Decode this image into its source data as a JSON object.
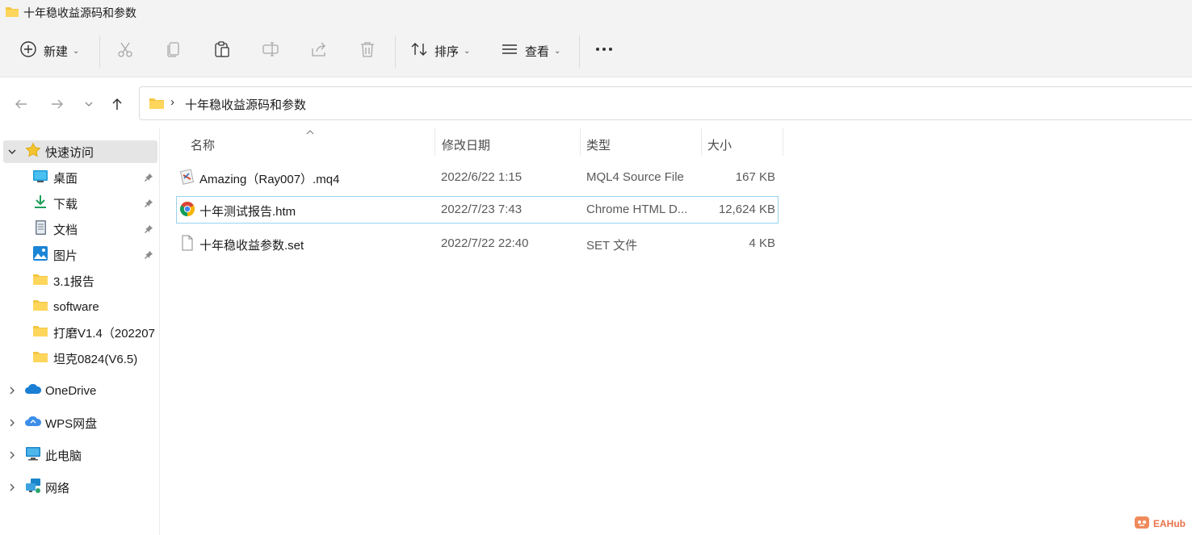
{
  "window": {
    "title": "十年稳收益源码和参数"
  },
  "toolbar": {
    "new_label": "新建",
    "sort_label": "排序",
    "view_label": "查看",
    "more_label": "···"
  },
  "address": {
    "path": "十年稳收益源码和参数"
  },
  "sidebar": {
    "quick_access": "快速访问",
    "items": [
      {
        "label": "桌面",
        "icon": "desktop-icon",
        "pinned": true
      },
      {
        "label": "下载",
        "icon": "download-icon",
        "pinned": true
      },
      {
        "label": "文档",
        "icon": "document-icon",
        "pinned": true
      },
      {
        "label": "图片",
        "icon": "picture-icon",
        "pinned": true
      },
      {
        "label": "3.1报告",
        "icon": "folder-icon",
        "pinned": false
      },
      {
        "label": "software",
        "icon": "folder-icon",
        "pinned": false
      },
      {
        "label": "打磨V1.4（202207",
        "icon": "folder-icon",
        "pinned": false
      },
      {
        "label": "坦克0824(V6.5)",
        "icon": "folder-icon",
        "pinned": false
      }
    ],
    "roots": [
      {
        "label": "OneDrive",
        "icon": "onedrive-cloud-icon"
      },
      {
        "label": "WPS网盘",
        "icon": "wps-cloud-icon"
      },
      {
        "label": "此电脑",
        "icon": "computer-icon"
      },
      {
        "label": "网络",
        "icon": "network-icon"
      }
    ]
  },
  "columns": {
    "name": "名称",
    "modified": "修改日期",
    "type": "类型",
    "size": "大小"
  },
  "files": [
    {
      "name": "Amazing（Ray007）.mq4",
      "modified": "2022/6/22 1:15",
      "type": "MQL4 Source File",
      "size": "167 KB",
      "icon": "mql4-file-icon"
    },
    {
      "name": "十年测试报告.htm",
      "modified": "2022/7/23 7:43",
      "type": "Chrome HTML D...",
      "size": "12,624 KB",
      "icon": "chrome-icon"
    },
    {
      "name": "十年稳收益参数.set",
      "modified": "2022/7/22 22:40",
      "type": "SET 文件",
      "size": "4 KB",
      "icon": "blank-file-icon"
    }
  ],
  "watermark": "EAHub",
  "colors": {
    "folder": "#f5c542",
    "selection": "#e5e5e5",
    "focus_border": "#99d1ee",
    "accent": "#0067c0"
  }
}
